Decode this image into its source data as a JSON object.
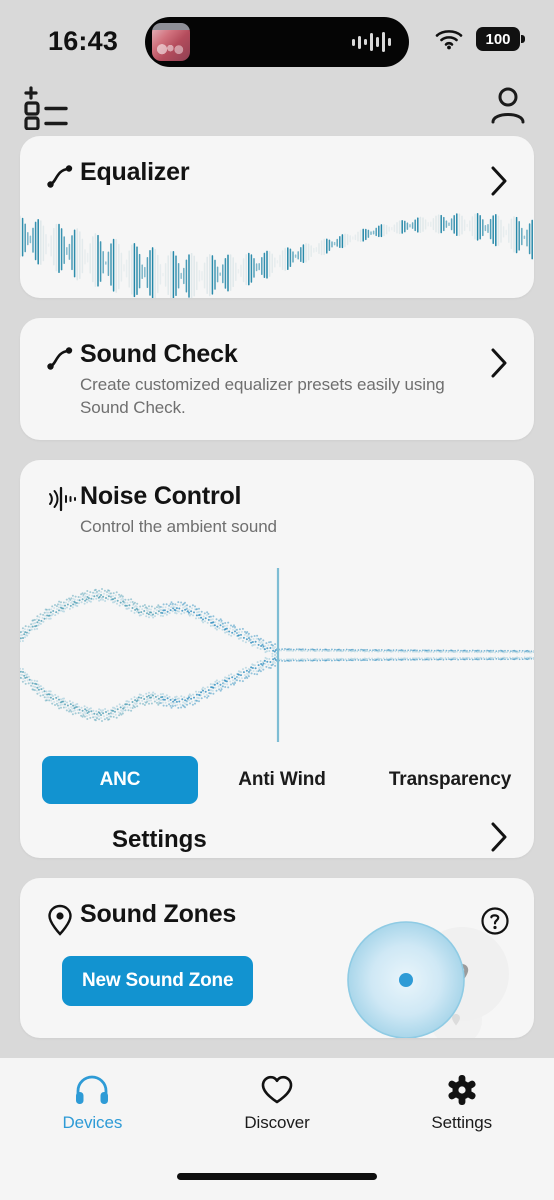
{
  "status_bar": {
    "time": "16:43",
    "battery_level": "100",
    "wifi_icon": "wifi-icon",
    "battery_icon": "battery-icon",
    "dynamic_island": {
      "album_art_icon": "album-artwork",
      "audio_waveform_icon": "audio-waveform-icon"
    }
  },
  "app_bar": {
    "device_list_icon": "add-device-list-icon",
    "profile_icon": "user-profile-icon"
  },
  "cards": {
    "equalizer": {
      "title": "Equalizer",
      "icon": "eq-curve-icon",
      "chevron": "chevron-right-icon"
    },
    "sound_check": {
      "title": "Sound Check",
      "subtitle": "Create customized equalizer presets easily using Sound Check.",
      "icon": "eq-curve-icon",
      "chevron": "chevron-right-icon"
    },
    "noise_control": {
      "title": "Noise Control",
      "subtitle": "Control the ambient sound",
      "icon": "noise-cancel-icon",
      "modes": [
        {
          "label": "ANC",
          "selected": true
        },
        {
          "label": "Anti Wind",
          "selected": false
        },
        {
          "label": "Transparency",
          "selected": false
        }
      ],
      "settings_label": "Settings",
      "settings_chevron": "chevron-right-icon"
    },
    "sound_zones": {
      "title": "Sound Zones",
      "icon": "location-pin-icon",
      "help_icon": "help-circle-icon",
      "new_zone_button": "New Sound Zone",
      "zone_map_icon": "sound-zone-radius"
    }
  },
  "tab_bar": {
    "tabs": [
      {
        "label": "Devices",
        "icon": "headphones-icon",
        "active": true
      },
      {
        "label": "Discover",
        "icon": "heart-icon",
        "active": false
      },
      {
        "label": "Settings",
        "icon": "gear-icon",
        "active": false
      }
    ]
  },
  "colors": {
    "accent_blue": "#1293d0",
    "tab_active_blue": "#2e9bd6",
    "page_background": "#d9d9d9",
    "card_background": "#f6f6f6",
    "wave_teal": "#2387a8"
  }
}
